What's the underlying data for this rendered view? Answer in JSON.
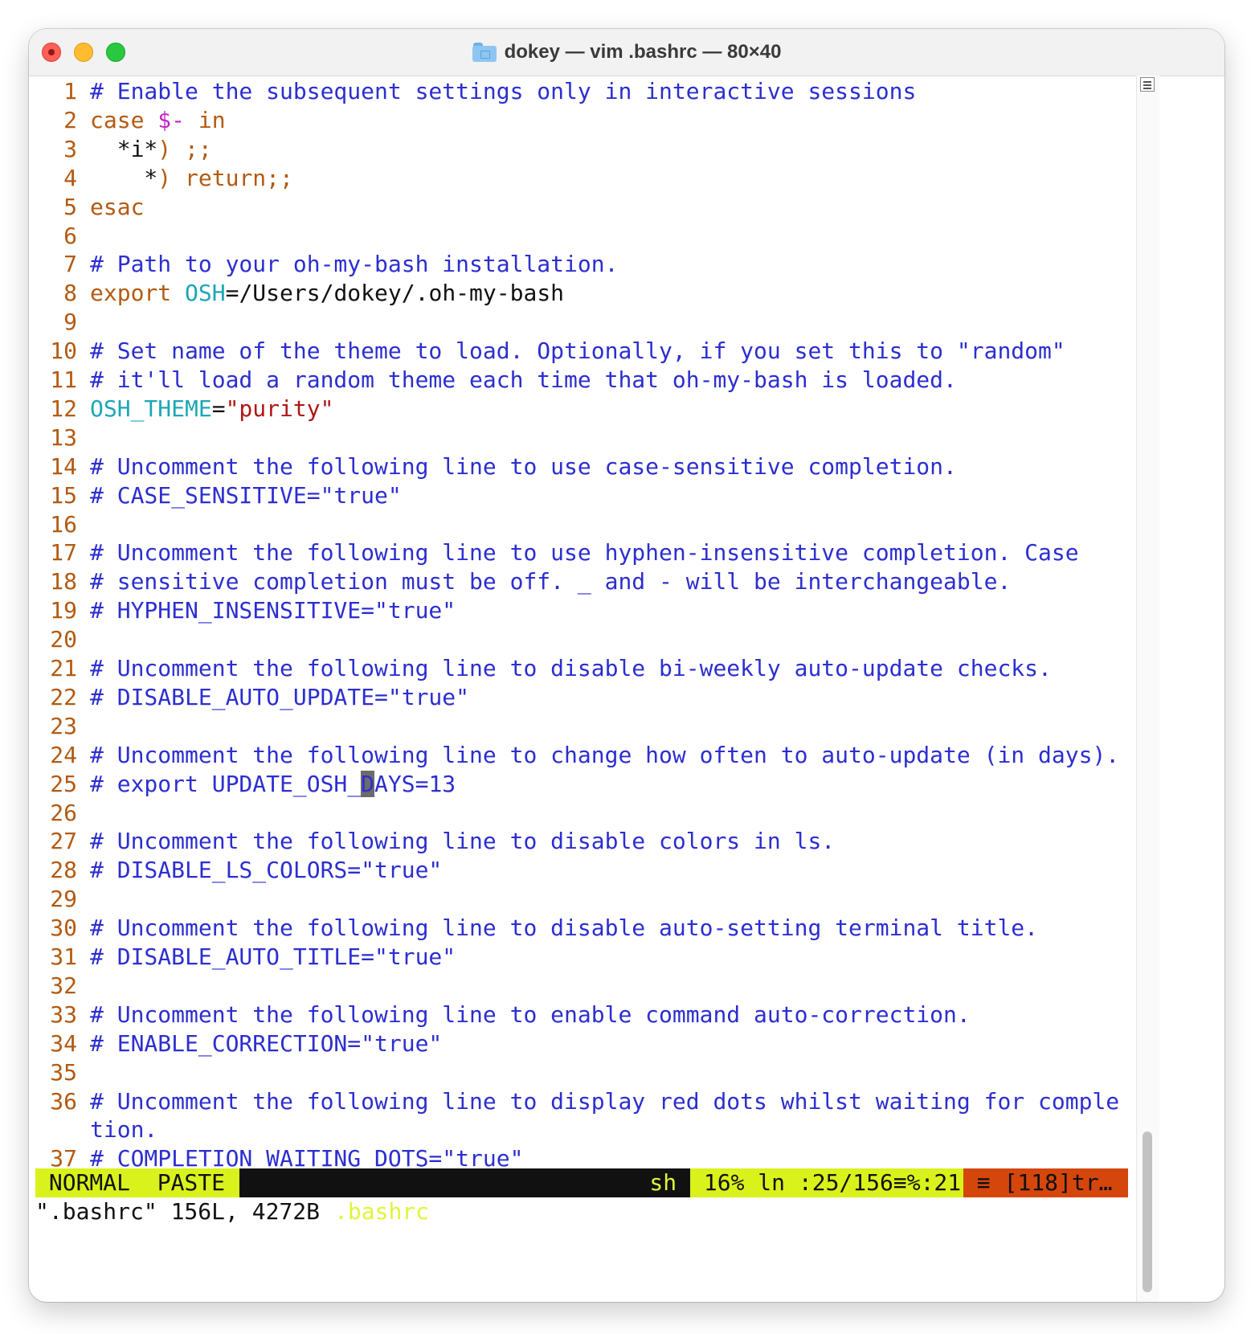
{
  "window": {
    "title": "dokey — vim .bashrc — 80×40"
  },
  "lines": [
    {
      "n": "1",
      "spans": [
        {
          "t": "# Enable the subsequent settings only in interactive sessions",
          "c": "c-comment"
        }
      ]
    },
    {
      "n": "2",
      "spans": [
        {
          "t": "case ",
          "c": "c-kw"
        },
        {
          "t": "$-",
          "c": "c-special"
        },
        {
          "t": " in",
          "c": "c-kw"
        }
      ]
    },
    {
      "n": "3",
      "spans": [
        {
          "t": "  *i*",
          "c": "c-plain"
        },
        {
          "t": ") ;;",
          "c": "c-kw"
        }
      ]
    },
    {
      "n": "4",
      "spans": [
        {
          "t": "    *",
          "c": "c-plain"
        },
        {
          "t": ") return;;",
          "c": "c-kw"
        }
      ]
    },
    {
      "n": "5",
      "spans": [
        {
          "t": "esac",
          "c": "c-kw"
        }
      ]
    },
    {
      "n": "6",
      "spans": []
    },
    {
      "n": "7",
      "spans": [
        {
          "t": "# Path to your oh-my-bash installation.",
          "c": "c-comment"
        }
      ]
    },
    {
      "n": "8",
      "spans": [
        {
          "t": "export ",
          "c": "c-kw"
        },
        {
          "t": "OSH",
          "c": "c-var"
        },
        {
          "t": "=/Users/dokey/.oh-my-bash",
          "c": "c-plain"
        }
      ]
    },
    {
      "n": "9",
      "spans": []
    },
    {
      "n": "10",
      "spans": [
        {
          "t": "# Set name of the theme to load. Optionally, if you set this to \"random\"",
          "c": "c-comment"
        }
      ]
    },
    {
      "n": "11",
      "spans": [
        {
          "t": "# it'll load a random theme each time that oh-my-bash is loaded.",
          "c": "c-comment"
        }
      ]
    },
    {
      "n": "12",
      "spans": [
        {
          "t": "OSH_THEME",
          "c": "c-var"
        },
        {
          "t": "=",
          "c": "c-plain"
        },
        {
          "t": "\"purity\"",
          "c": "c-str"
        }
      ]
    },
    {
      "n": "13",
      "spans": []
    },
    {
      "n": "14",
      "spans": [
        {
          "t": "# Uncomment the following line to use case-sensitive completion.",
          "c": "c-comment"
        }
      ]
    },
    {
      "n": "15",
      "spans": [
        {
          "t": "# CASE_SENSITIVE=\"true\"",
          "c": "c-comment"
        }
      ]
    },
    {
      "n": "16",
      "spans": []
    },
    {
      "n": "17",
      "spans": [
        {
          "t": "# Uncomment the following line to use hyphen-insensitive completion. Case",
          "c": "c-comment"
        }
      ]
    },
    {
      "n": "18",
      "spans": [
        {
          "t": "# sensitive completion must be off. _ and - will be interchangeable.",
          "c": "c-comment"
        }
      ]
    },
    {
      "n": "19",
      "spans": [
        {
          "t": "# HYPHEN_INSENSITIVE=\"true\"",
          "c": "c-comment"
        }
      ]
    },
    {
      "n": "20",
      "spans": []
    },
    {
      "n": "21",
      "spans": [
        {
          "t": "# Uncomment the following line to disable bi-weekly auto-update checks.",
          "c": "c-comment"
        }
      ]
    },
    {
      "n": "22",
      "spans": [
        {
          "t": "# DISABLE_AUTO_UPDATE=\"true\"",
          "c": "c-comment"
        }
      ]
    },
    {
      "n": "23",
      "spans": []
    },
    {
      "n": "24",
      "spans": [
        {
          "t": "# Uncomment the following line to change how often to auto-update (in days).",
          "c": "c-comment"
        }
      ]
    },
    {
      "n": "25",
      "spans": [
        {
          "t": "# export UPDATE_OSH_",
          "c": "c-comment"
        },
        {
          "t": "D",
          "c": "c-comment cursor"
        },
        {
          "t": "AYS=13",
          "c": "c-comment"
        }
      ]
    },
    {
      "n": "26",
      "spans": []
    },
    {
      "n": "27",
      "spans": [
        {
          "t": "# Uncomment the following line to disable colors in ls.",
          "c": "c-comment"
        }
      ]
    },
    {
      "n": "28",
      "spans": [
        {
          "t": "# DISABLE_LS_COLORS=\"true\"",
          "c": "c-comment"
        }
      ]
    },
    {
      "n": "29",
      "spans": []
    },
    {
      "n": "30",
      "spans": [
        {
          "t": "# Uncomment the following line to disable auto-setting terminal title.",
          "c": "c-comment"
        }
      ]
    },
    {
      "n": "31",
      "spans": [
        {
          "t": "# DISABLE_AUTO_TITLE=\"true\"",
          "c": "c-comment"
        }
      ]
    },
    {
      "n": "32",
      "spans": []
    },
    {
      "n": "33",
      "spans": [
        {
          "t": "# Uncomment the following line to enable command auto-correction.",
          "c": "c-comment"
        }
      ]
    },
    {
      "n": "34",
      "spans": [
        {
          "t": "# ENABLE_CORRECTION=\"true\"",
          "c": "c-comment"
        }
      ]
    },
    {
      "n": "35",
      "spans": []
    },
    {
      "n": "36",
      "spans": [
        {
          "t": "# Uncomment the following line to display red dots whilst waiting for comple",
          "c": "c-comment"
        }
      ]
    },
    {
      "n": "",
      "spans": [
        {
          "t": "tion.",
          "c": "c-comment"
        }
      ]
    },
    {
      "n": "37",
      "spans": [
        {
          "t": "# COMPLETION_WAITING_DOTS=\"true\"",
          "c": "c-comment"
        }
      ]
    }
  ],
  "statusline": {
    "mode": " NORMAL  PASTE ",
    "file": " .bashrc",
    "filetype": "sh ",
    "position": " 16% ln :25/156≡%:21 ",
    "warning": " ≡ [118]tr… "
  },
  "message": "\".bashrc\" 156L, 4272B"
}
